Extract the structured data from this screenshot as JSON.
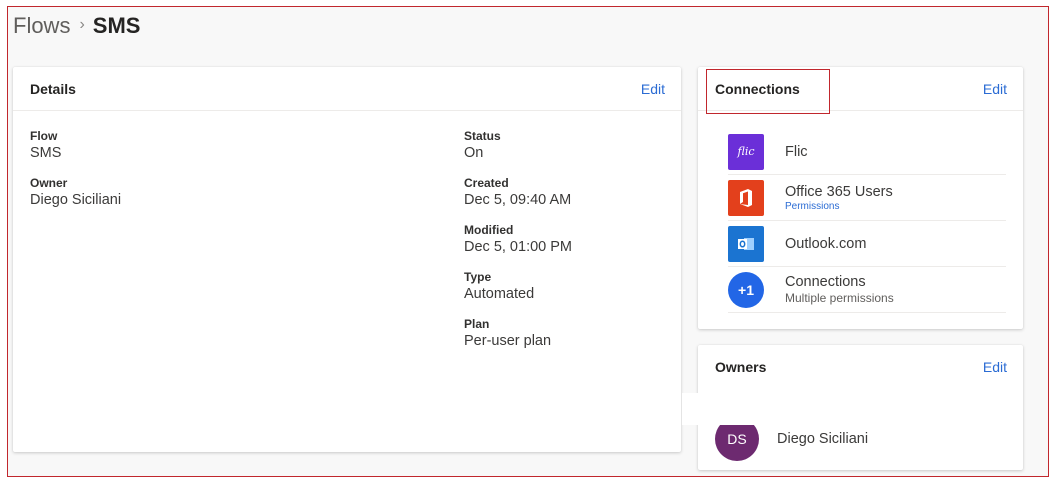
{
  "breadcrumb": {
    "parent": "Flows",
    "separator": "›",
    "current": "SMS"
  },
  "details": {
    "title": "Details",
    "edit_label": "Edit",
    "left_fields": [
      {
        "label": "Flow",
        "value": "SMS"
      },
      {
        "label": "Owner",
        "value": "Diego Siciliani"
      }
    ],
    "right_fields": [
      {
        "label": "Status",
        "value": "On"
      },
      {
        "label": "Created",
        "value": "Dec 5, 09:40 AM"
      },
      {
        "label": "Modified",
        "value": "Dec 5, 01:00 PM"
      },
      {
        "label": "Type",
        "value": "Automated"
      },
      {
        "label": "Plan",
        "value": "Per-user plan"
      }
    ]
  },
  "connections": {
    "title": "Connections",
    "edit_label": "Edit",
    "items": [
      {
        "name": "Flic",
        "icon": "flic-icon",
        "icon_text": "flic"
      },
      {
        "name": "Office 365 Users",
        "sub_link": "Permissions",
        "icon": "office365-icon"
      },
      {
        "name": "Outlook.com",
        "icon": "outlook-icon"
      },
      {
        "name": "Connections",
        "sub": "Multiple permissions",
        "icon": "plus-one-icon",
        "icon_text": "+1"
      }
    ]
  },
  "owners": {
    "title": "Owners",
    "edit_label": "Edit",
    "items": [
      {
        "initials": "DS",
        "name": "Diego Siciliani"
      }
    ]
  },
  "colors": {
    "accent": "#2b6cd4",
    "highlight": "#c1272d",
    "avatar": "#6d2a70"
  }
}
